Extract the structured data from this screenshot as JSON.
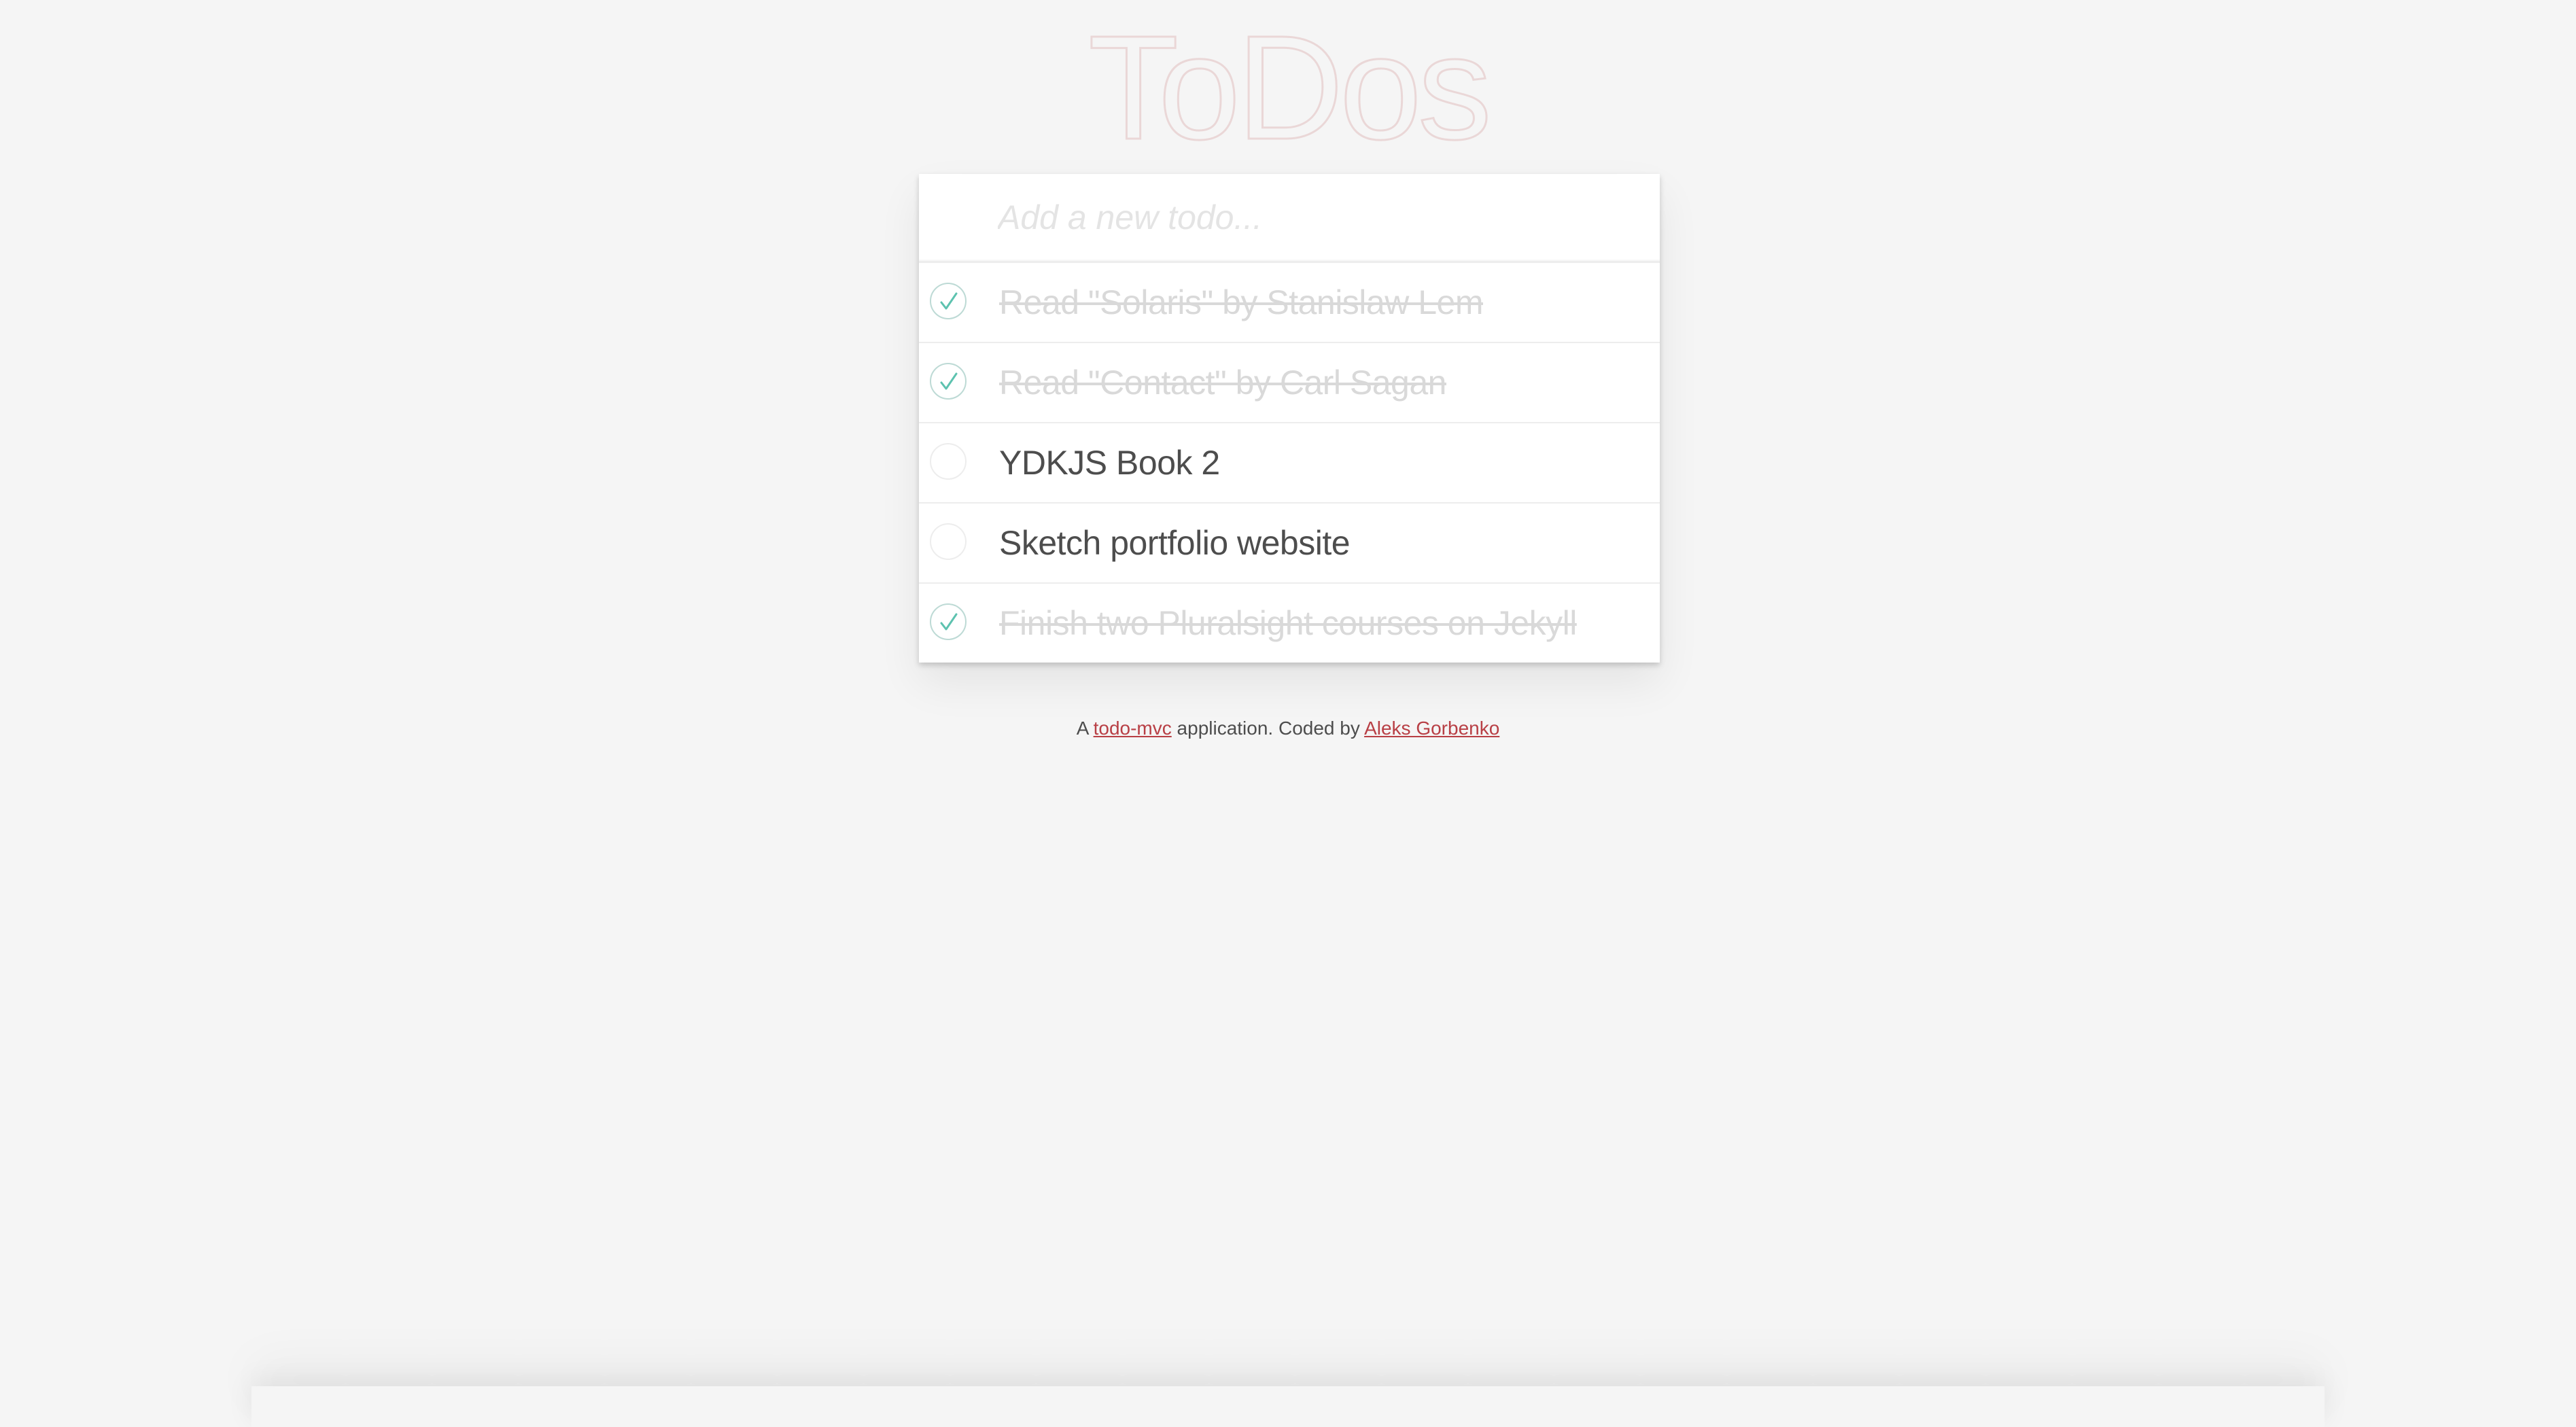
{
  "header": {
    "title": "ToDos"
  },
  "new_todo": {
    "placeholder": "Add a new todo...",
    "value": ""
  },
  "todos": [
    {
      "label": "Read \"Solaris\" by Stanislaw Lem",
      "completed": true
    },
    {
      "label": "Read \"Contact\" by Carl Sagan",
      "completed": true
    },
    {
      "label": "YDKJS Book 2",
      "completed": false
    },
    {
      "label": "Sketch portfolio website",
      "completed": false
    },
    {
      "label": "Finish two Pluralsight courses on Jekyll",
      "completed": true
    }
  ],
  "footer": {
    "prefix": "A ",
    "link1": "todo-mvc",
    "middle": " application. Coded by ",
    "link2": "Aleks Gorbenko"
  },
  "icons": {
    "checked": "checkmark-icon",
    "unchecked": "empty-circle-icon"
  },
  "colors": {
    "background": "#f5f5f5",
    "title": "#ead7d7",
    "check": "#5dc2af",
    "check_border": "#bddad5",
    "completed_text": "#d9d9d9",
    "active_text": "#4d4d4d",
    "link": "#b83f45"
  }
}
